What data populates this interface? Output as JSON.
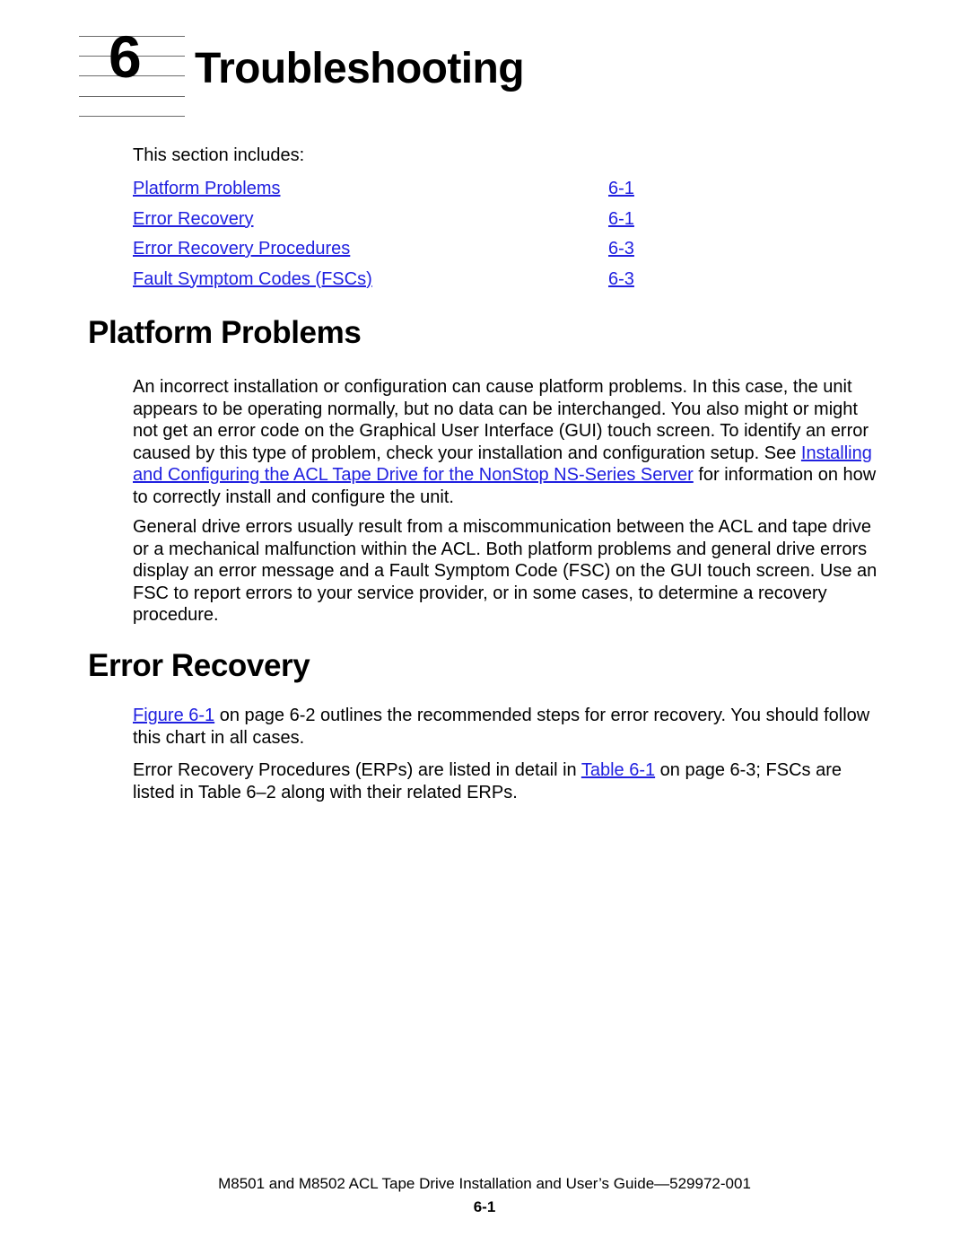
{
  "chapter": {
    "number": "6",
    "title": "Troubleshooting"
  },
  "intro": {
    "text": "This section includes:"
  },
  "toc": {
    "items": [
      {
        "label": "Platform Problems",
        "page": "6-1"
      },
      {
        "label": "Error Recovery",
        "page": "6-1"
      },
      {
        "label": "Error Recovery Procedures",
        "page": "6-3"
      },
      {
        "label": "Fault Symptom Codes (FSCs)",
        "page": "6-3"
      }
    ]
  },
  "sections": {
    "platform_problems": {
      "heading": "Platform Problems",
      "para1_before_link": "An incorrect installation or configuration can cause platform problems. In this case, the unit appears to be operating normally, but no data can be interchanged. You also might or might not get an error code on the Graphical User Interface (GUI) touch screen. To identify an error caused by this type of problem, check your installation and configuration setup. See ",
      "para1_link": "Installing and Configuring the ACL Tape Drive for the NonStop NS-Series Server",
      "para1_after_link": " for information on how to correctly install and configure the unit.",
      "para2": "General drive errors usually result from a miscommunication between the ACL and tape drive or a mechanical malfunction within the ACL. Both platform problems and general drive errors display an error message and a Fault Symptom Code (FSC) on the GUI touch screen. Use an FSC to report errors to your service provider, or in some cases, to determine a recovery procedure."
    },
    "error_recovery": {
      "heading": "Error Recovery",
      "para1_link": "Figure 6-1",
      "para1_after_link": " on page 6-2 outlines the recommended steps for error recovery. You should follow this chart in all cases.",
      "para2_before_link": "Error Recovery Procedures (ERPs) are listed in detail in ",
      "para2_link": "Table 6-1",
      "para2_after_link": " on page 6-3; FSCs are listed in Table 6–2 along with their related ERPs."
    }
  },
  "footer": {
    "guide_line": "M8501 and M8502 ACL Tape Drive Installation and User’s Guide—529972-001",
    "page_number": "6-1"
  },
  "colors": {
    "link": "#2020e0",
    "text": "#000000",
    "background": "#ffffff",
    "rule": "#6b6b6b"
  }
}
